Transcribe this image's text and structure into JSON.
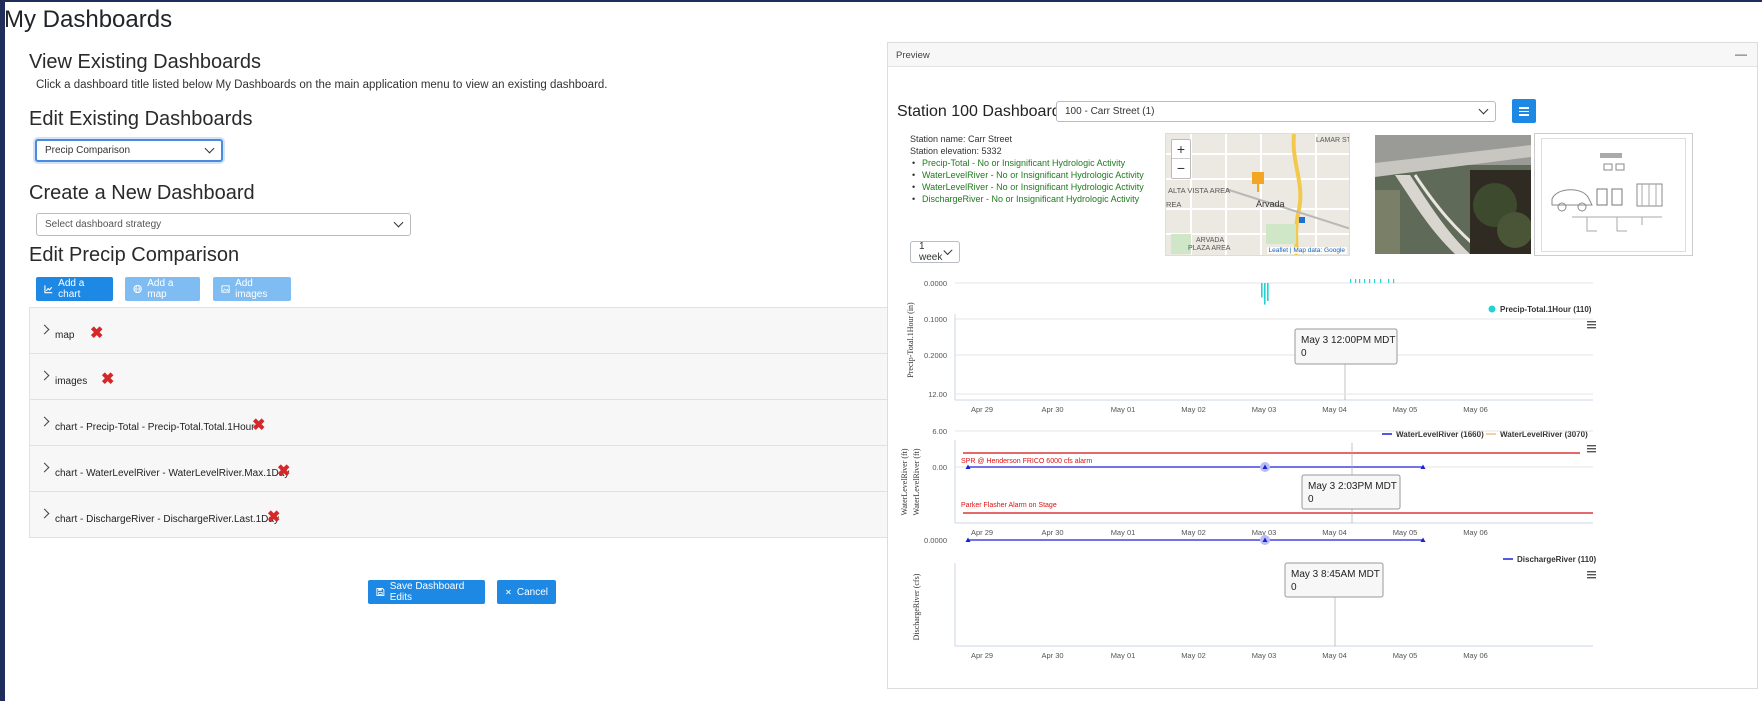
{
  "page": {
    "title": "My Dashboards"
  },
  "view": {
    "heading": "View Existing Dashboards",
    "help": "Click a dashboard title listed below My Dashboards on the main application menu to view an existing dashboard."
  },
  "edit": {
    "heading": "Edit Existing Dashboards",
    "selected": "Precip Comparison"
  },
  "create": {
    "heading": "Create a New Dashboard",
    "strategy_placeholder": "Select dashboard strategy"
  },
  "editor": {
    "heading": "Edit Precip Comparison",
    "buttons": {
      "add_chart": "Add a chart",
      "add_map": "Add a map",
      "add_images": "Add images"
    },
    "items": [
      {
        "label": "map"
      },
      {
        "label": "images"
      },
      {
        "label": "chart - Precip-Total - Precip-Total.Total.1Hour"
      },
      {
        "label": "chart - WaterLevelRiver - WaterLevelRiver.Max.1Day"
      },
      {
        "label": "chart - DischargeRiver - DischargeRiver.Last.1Day"
      }
    ],
    "delete_icon": "✖",
    "save_label": "Save Dashboard Edits",
    "cancel_label": "Cancel"
  },
  "preview": {
    "title": "Preview",
    "minimize_glyph": "—",
    "station_title": "Station 100 Dashboard",
    "station_select": "100 - Carr Street (1)",
    "station_name": "Station name: Carr Street",
    "station_elevation": "Station elevation: 5332",
    "statuses": [
      "Precip-Total - No or Insignificant Hydrologic Activity",
      "WaterLevelRiver - No or Insignificant Hydrologic Activity",
      "WaterLevelRiver - No or Insignificant Hydrologic Activity",
      "DischargeRiver - No or Insignificant Hydrologic Activity"
    ],
    "map": {
      "zoom_in": "+",
      "zoom_out": "−",
      "attribution": "Leaflet | Map data: Google",
      "labels": [
        "LAMAR ST",
        "ALTA VISTA AREA",
        "Arvada",
        "ARVADA PLAZA AREA",
        "REA"
      ]
    },
    "range": "1 week",
    "colors": {
      "primary": "#1e88e5",
      "precip": "#22d3d3",
      "level": "#1a22d6",
      "alarm": "#d11111",
      "ok": "#1f7a1f"
    }
  },
  "charts": {
    "x_ticks": [
      "Apr 29",
      "Apr 30",
      "May 01",
      "May 02",
      "May 03",
      "May 04",
      "May 05",
      "May 06"
    ],
    "precip": {
      "ylabel": "Precip-Total.1Hour (in)",
      "y_ticks": [
        "0.0000",
        "0.1000",
        "0.2000"
      ],
      "legend": "Precip-Total.1Hour (110)",
      "tooltip_time": "May 3 12:00PM MDT",
      "tooltip_value": "0"
    },
    "level": {
      "ylabel_1": "WaterLevelRiver (ft)",
      "ylabel_2": "WaterLevelRiver (ft)",
      "y_ticks": [
        "12.00",
        "6.00",
        "0.00"
      ],
      "legend_1": "WaterLevelRiver (1660)",
      "legend_2": "WaterLevelRiver (3070)",
      "alarm_1": "SPR @ Henderson FRICO 6000 cfs alarm",
      "alarm_2": "Parker Flasher Alarm on Stage",
      "tooltip_time": "May 3 2:03PM MDT",
      "tooltip_value": "0"
    },
    "discharge": {
      "ylabel": "DischargeRiver (cfs)",
      "y_ticks": [
        "0.0000"
      ],
      "legend": "DischargeRiver (110)",
      "tooltip_time": "May 3 8:45AM MDT",
      "tooltip_value": "0"
    }
  },
  "chart_data": [
    {
      "type": "bar",
      "ylabel": "Precip-Total.1Hour (in)",
      "ylim": [
        0,
        0.2
      ],
      "y_inverted": true,
      "legend": "top-right",
      "series": [
        {
          "name": "Precip-Total.1Hour (110)",
          "color": "#22d3d3",
          "x": [
            "May 03",
            "May 03",
            "May 03"
          ],
          "values": [
            0.04,
            0.06,
            0.05
          ]
        }
      ]
    },
    {
      "type": "line",
      "ylabel": "WaterLevelRiver (ft)",
      "ylim": [
        0,
        12
      ],
      "legend": "top-right",
      "series": [
        {
          "name": "WaterLevelRiver (1660)",
          "color": "#1a22d6",
          "x": [
            "Apr 29",
            "May 03",
            "May 05"
          ],
          "values": [
            0,
            0,
            0
          ]
        },
        {
          "name": "WaterLevelRiver (3070)",
          "color": "#f0c08a",
          "x": [],
          "values": []
        }
      ]
    },
    {
      "type": "line",
      "ylabel": "DischargeRiver (cfs)",
      "legend": "top-right",
      "series": [
        {
          "name": "DischargeRiver (110)",
          "color": "#1a22d6",
          "x": [
            "Apr 29",
            "May 03",
            "May 05"
          ],
          "values": [
            0,
            0,
            0
          ]
        }
      ]
    }
  ]
}
